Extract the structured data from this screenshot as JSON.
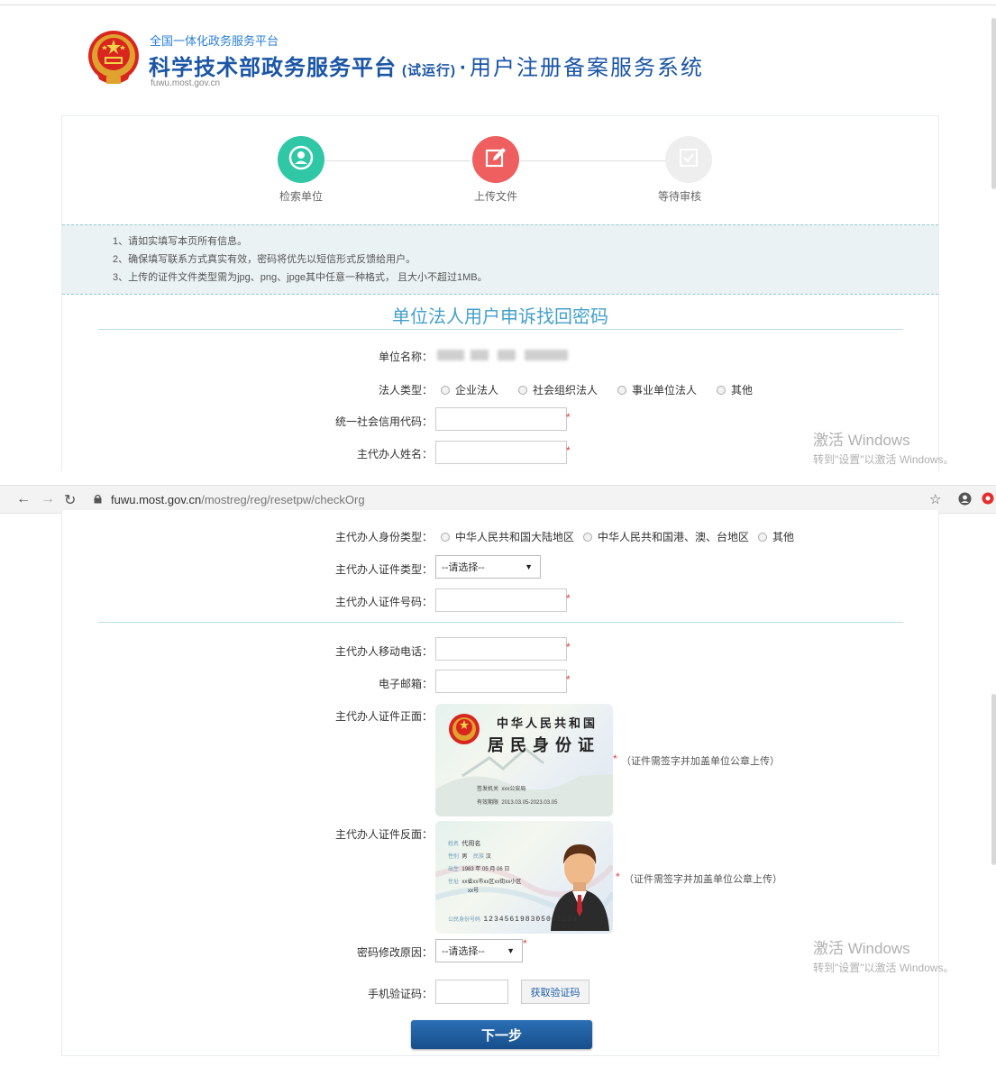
{
  "header": {
    "platform_small": "全国一体化政务服务平台",
    "title_main": "科学技术部政务服务平台",
    "title_trial": "(试运行)",
    "title_dot": "·",
    "title_sub": "用户注册备案服务系统",
    "domain": "fuwu.most.gov.cn"
  },
  "steps": [
    {
      "label": "检索单位",
      "icon": "user-circle-icon",
      "color": "#2fc7a6",
      "state": "done"
    },
    {
      "label": "上传文件",
      "icon": "edit-icon",
      "color": "#ef5f5f",
      "state": "current"
    },
    {
      "label": "等待审核",
      "icon": "check-box-icon",
      "color": "#ececec",
      "state": "pending"
    }
  ],
  "notices": [
    "1、请如实填写本页所有信息。",
    "2、确保填写联系方式真实有效，密码将优先以短信形式反馈给用户。",
    "3、上传的证件文件类型需为jpg、png、jpge其中任意一种格式， 且大小不超过1MB。"
  ],
  "form": {
    "title": "单位法人用户申诉找回密码",
    "org_name_label": "单位名称：",
    "legal_type_label": "法人类型：",
    "legal_type_options": [
      "企业法人",
      "社会组织法人",
      "事业单位法人",
      "其他"
    ],
    "credit_code_label": "统一社会信用代码：",
    "agent_name_label": "主代办人姓名：",
    "agent_id_type_label": "主代办人身份类型：",
    "agent_id_type_options": [
      "中华人民共和国大陆地区",
      "中华人民共和国港、澳、台地区",
      "其他"
    ],
    "agent_cert_type_label": "主代办人证件类型：",
    "agent_cert_type_value": "--请选择--",
    "agent_cert_no_label": "主代办人证件号码：",
    "agent_mobile_label": "主代办人移动电话：",
    "email_label": "电子邮箱：",
    "cert_front_label": "主代办人证件正面：",
    "cert_back_label": "主代办人证件反面：",
    "cert_note": "（证件需签字并加盖单位公章上传）",
    "reason_label": "密码修改原因：",
    "reason_value": "--请选择--",
    "sms_label": "手机验证码：",
    "get_code_label": "获取验证码",
    "next_label": "下一步",
    "required_mark": "*"
  },
  "id_front": {
    "country": "中华人民共和国",
    "title": "居民身份证",
    "authority_label": "签发机关",
    "authority_value": "xxx公安局",
    "validity_label": "有效期限",
    "validity_value": "2013.03.05-2023.03.05"
  },
  "id_back": {
    "name_label": "姓名",
    "name_value": "代用名",
    "sex_label": "性别",
    "sex_value": "男",
    "ethnic_label": "民族",
    "ethnic_value": "汉",
    "birth_label": "出生",
    "birth_value": "1983 年 05 月 06 日",
    "addr_label": "住址",
    "addr_value": "xx省xx市xx区xx街xx小区",
    "addr_value2": "xx号",
    "idno_label": "公民身份号码",
    "idno_value": "123456198305061234"
  },
  "browser": {
    "url_host": "fuwu.most.gov.cn",
    "url_path": "/mostreg/reg/resetpw/checkOrg"
  },
  "watermark": {
    "line1": "激活 Windows",
    "line2": "转到\"设置\"以激活 Windows。"
  }
}
